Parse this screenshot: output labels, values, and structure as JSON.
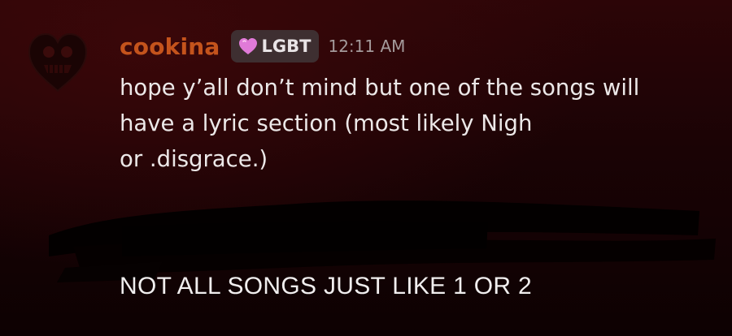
{
  "message": {
    "username": "cookina",
    "role": {
      "label": "LGBT",
      "icon": "pink-heart-icon",
      "icon_color": "#e07ad8"
    },
    "timestamp": "12:11 AM",
    "body_lines": [
      "hope y’all don’t mind but one of the songs will",
      "have a lyric section (most likely Nigh",
      "or .disgrace.)"
    ],
    "avatar_icon": "dark-heart-skull-avatar-icon"
  },
  "caption": "NOT ALL SONGS JUST LIKE 1 OR 2",
  "colors": {
    "username": "#c4531c",
    "background_top": "#2c0507",
    "background_bottom": "#0d0102",
    "role_tag_bg": "#3e2f31",
    "timestamp": "#a49a9b"
  }
}
